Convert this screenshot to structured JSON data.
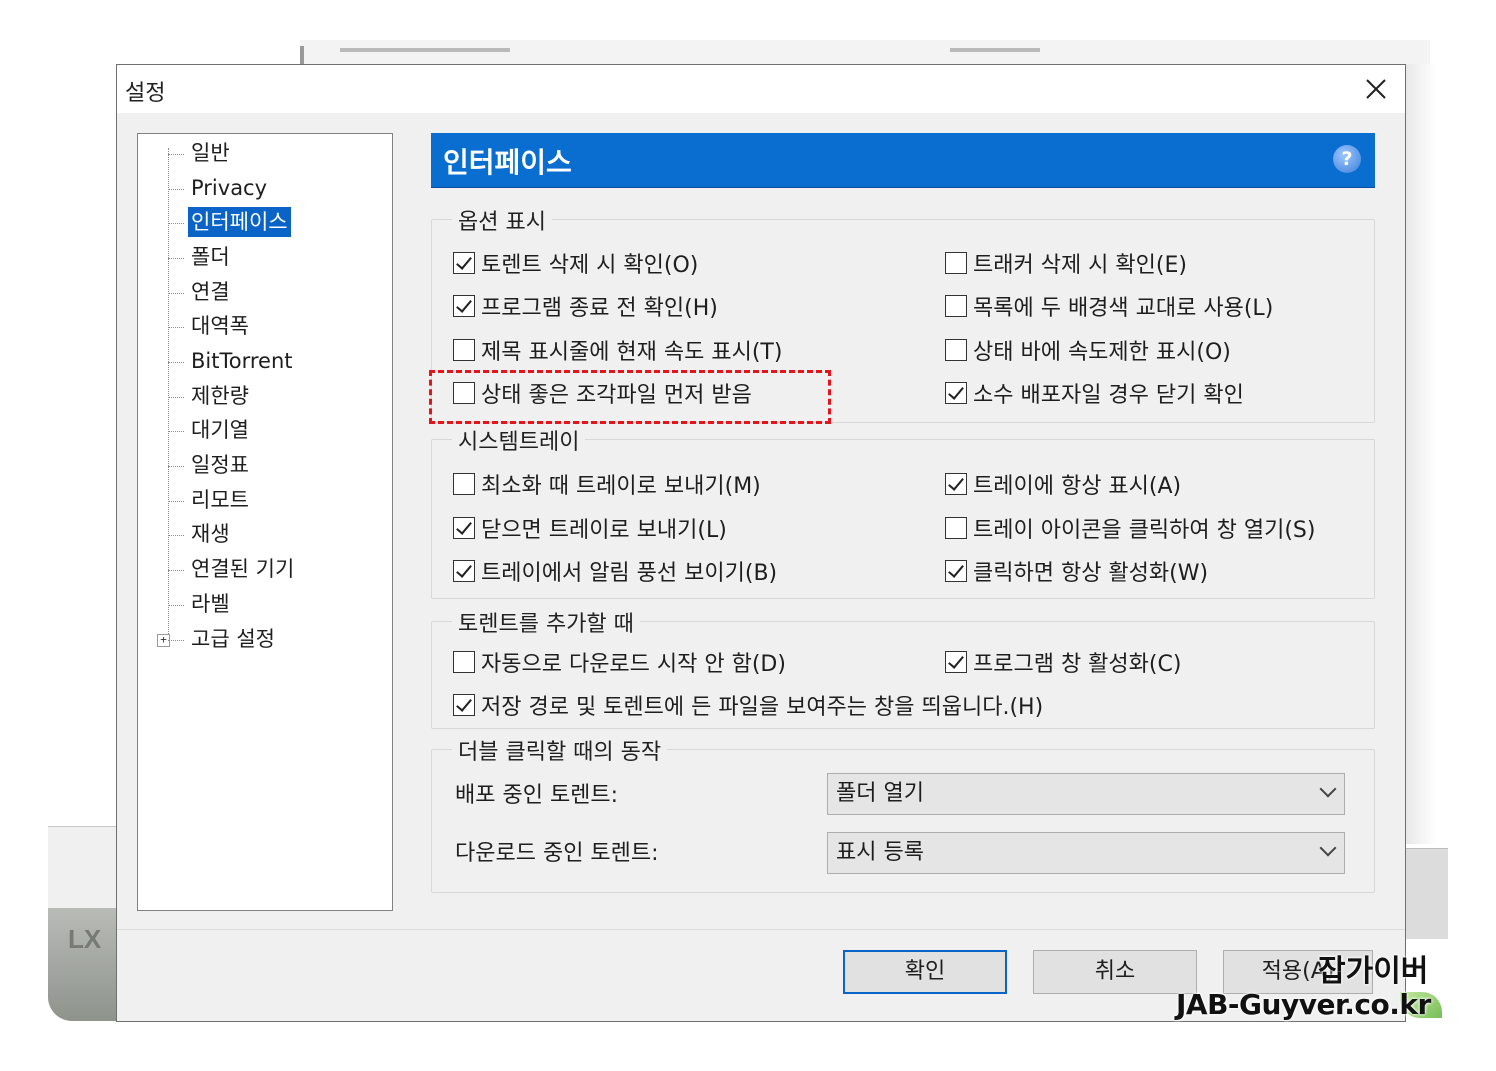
{
  "dialog": {
    "title": "설정",
    "close_symbol": "✕"
  },
  "tree": {
    "items": [
      {
        "label": "일반"
      },
      {
        "label": "Privacy"
      },
      {
        "label": "인터페이스",
        "selected": true
      },
      {
        "label": "폴더"
      },
      {
        "label": "연결"
      },
      {
        "label": "대역폭"
      },
      {
        "label": "BitTorrent"
      },
      {
        "label": "제한량"
      },
      {
        "label": "대기열"
      },
      {
        "label": "일정표"
      },
      {
        "label": "리모트"
      },
      {
        "label": "재생"
      },
      {
        "label": "연결된 기기"
      },
      {
        "label": "라벨"
      },
      {
        "label": "고급 설정",
        "expandable": true,
        "expander": "+"
      }
    ]
  },
  "panel": {
    "title": "인터페이스",
    "help_symbol": "?"
  },
  "groups": {
    "options": {
      "label": "옵션 표시",
      "items": [
        {
          "label": "토렌트 삭제 시 확인(O)",
          "checked": true
        },
        {
          "label": "트래커 삭제 시 확인(E)",
          "checked": false
        },
        {
          "label": "프로그램 종료 전 확인(H)",
          "checked": true
        },
        {
          "label": "목록에 두 배경색 교대로 사용(L)",
          "checked": false
        },
        {
          "label": "제목 표시줄에 현재 속도 표시(T)",
          "checked": false
        },
        {
          "label": "상태 바에 속도제한 표시(O)",
          "checked": false
        },
        {
          "label": "상태 좋은 조각파일 먼저 받음",
          "checked": false,
          "highlighted": true
        },
        {
          "label": "소수 배포자일 경우 닫기 확인",
          "checked": true
        }
      ]
    },
    "tray": {
      "label": "시스템트레이",
      "items": [
        {
          "label": "최소화 때 트레이로 보내기(M)",
          "checked": false
        },
        {
          "label": "트레이에 항상 표시(A)",
          "checked": true
        },
        {
          "label": "닫으면 트레이로 보내기(L)",
          "checked": true
        },
        {
          "label": "트레이 아이콘을 클릭하여 창 열기(S)",
          "checked": false
        },
        {
          "label": "트레이에서 알림 풍선 보이기(B)",
          "checked": true
        },
        {
          "label": "클릭하면 항상 활성화(W)",
          "checked": true
        }
      ]
    },
    "add": {
      "label": "토렌트를 추가할 때",
      "items": [
        {
          "label": "자동으로 다운로드 시작 안 함(D)",
          "checked": false
        },
        {
          "label": "프로그램 창 활성화(C)",
          "checked": true
        },
        {
          "label": "저장 경로 및 토렌트에 든 파일을 보여주는 창을 띄웁니다.(H)",
          "checked": true
        }
      ]
    },
    "dblclick": {
      "label": "더블 클릭할 때의 동작",
      "seeding_label": "배포 중인 토렌트:",
      "seeding_value": "폴더 열기",
      "downloading_label": "다운로드 중인 토렌트:",
      "downloading_value": "표시 등록"
    }
  },
  "buttons": {
    "ok": "확인",
    "cancel": "취소",
    "apply": "적용(A)"
  },
  "watermark": {
    "line1": "잡가이버",
    "line2": "JAB-Guyver.co.kr"
  },
  "background": {
    "logo_text": "LX"
  }
}
